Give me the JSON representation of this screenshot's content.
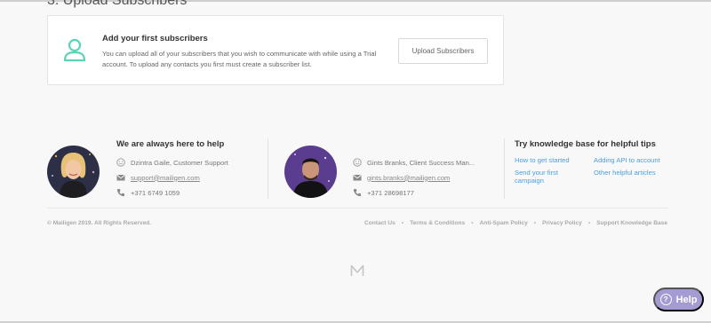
{
  "section": {
    "title": "3. Upload Subscribers"
  },
  "card": {
    "heading": "Add your first subscribers",
    "description": "You can upload all of your subscribers that you wish to communicate with while using a Trial account. To upload any contacts you first must create a subscriber list.",
    "button_label": "Upload Subscribers",
    "icon": "user-icon",
    "accent_color": "#5dd3b5"
  },
  "support": {
    "heading": "We are always here to help",
    "contacts": [
      {
        "name": "Dzintra Gaile, Customer Support",
        "email": "support@mailigen.com",
        "phone": "+371 6749 1059"
      },
      {
        "name": "Gints Branks, Client Success Man...",
        "email": "gints.branks@mailigen.com",
        "phone": "+371 28698177"
      }
    ]
  },
  "knowledge": {
    "heading": "Try knowledge base for helpful tips",
    "links": [
      "How to get started",
      "Adding API to account",
      "Send your first campaign",
      "Other helpful articles"
    ],
    "link_color": "#4a9fe0"
  },
  "footer": {
    "copyright": "© Mailigen 2019. All Rights Reserved.",
    "links": [
      "Contact Us",
      "Terms & Conditions",
      "Anti-Spam Policy",
      "Privacy Policy",
      "Support Knowledge Base"
    ]
  },
  "help_button": {
    "label": "Help",
    "color": "#a59bd3"
  }
}
